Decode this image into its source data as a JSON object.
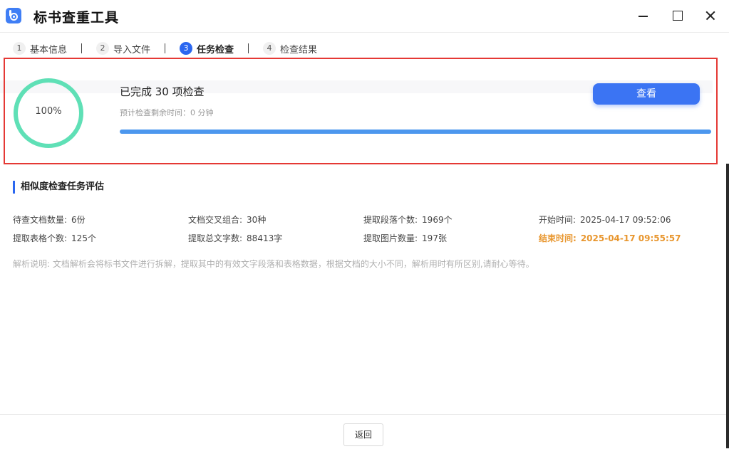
{
  "window": {
    "title": "标书查重工具"
  },
  "steps": [
    {
      "num": "1",
      "label": "基本信息"
    },
    {
      "num": "2",
      "label": "导入文件"
    },
    {
      "num": "3",
      "label": "任务检查"
    },
    {
      "num": "4",
      "label": "检查结果"
    }
  ],
  "active_step": 3,
  "progress": {
    "percent_text": "100%",
    "percent": 100,
    "done_text": "已完成 30 项检查",
    "eta_text": "预计检查剩余时间：0 分钟",
    "view_button": "查看",
    "ring_color": "#5fe0b6",
    "bar_color": "#4c97ee"
  },
  "section": {
    "title": "相似度检查任务评估"
  },
  "stats": [
    {
      "label": "待查文档数量:",
      "value": "6份"
    },
    {
      "label": "文档交叉组合:",
      "value": "30种"
    },
    {
      "label": "提取段落个数:",
      "value": "1969个"
    },
    {
      "label": "开始时间:",
      "value": "2025-04-17 09:52:06"
    },
    {
      "label": "提取表格个数:",
      "value": "125个"
    },
    {
      "label": "提取总文字数:",
      "value": "88413字"
    },
    {
      "label": "提取图片数量:",
      "value": "197张"
    },
    {
      "label": "结束时间:",
      "value": "2025-04-17 09:55:57"
    }
  ],
  "note": "解析说明: 文档解析会将标书文件进行拆解，提取其中的有效文字段落和表格数据，根据文档的大小不同，解析用时有所区别,请耐心等待。",
  "footer": {
    "back_button": "返回"
  },
  "colors": {
    "accent": "#2b67f0",
    "warning": "#e8962e",
    "highlight_border": "#e53935"
  }
}
